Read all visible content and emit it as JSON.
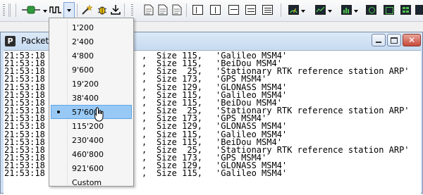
{
  "window": {
    "title": "Packet C"
  },
  "console_lines": [
    {
      "time": "21:53:18",
      "mid": ",",
      "size": "Size 115,",
      "msg": "'Galileo MSM4'"
    },
    {
      "time": "21:53:18",
      "mid": ",",
      "size": "Size 115,",
      "msg": "'BeiDou MSM4'"
    },
    {
      "time": "21:53:18",
      "mid": ",",
      "size": "Size  25,",
      "msg": "'Stationary RTK reference station ARP'"
    },
    {
      "time": "21:53:18",
      "mid": ",",
      "size": "Size 173,",
      "msg": "'GPS MSM4'"
    },
    {
      "time": "21:53:18",
      "mid": ",",
      "size": "Size 129,",
      "msg": "'GLONASS MSM4'"
    },
    {
      "time": "21:53:18",
      "mid": ",",
      "size": "Size 115,",
      "msg": "'Galileo MSM4'"
    },
    {
      "time": "21:53:18",
      "mid": ",",
      "size": "Size 115,",
      "msg": "'BeiDou MSM4'"
    },
    {
      "time": "21:53:18",
      "mid": ",",
      "size": "Size  25,",
      "msg": "'Stationary RTK reference station ARP'"
    },
    {
      "time": "21:53:18",
      "mid": ",",
      "size": "Size 173,",
      "msg": "'GPS MSM4'"
    },
    {
      "time": "21:53:18",
      "mid": ",",
      "size": "Size 129,",
      "msg": "'GLONASS MSM4'"
    },
    {
      "time": "21:53:18",
      "mid": ",",
      "size": "Size 115,",
      "msg": "'Galileo MSM4'"
    },
    {
      "time": "21:53:18",
      "mid": ",",
      "size": "Size 115,",
      "msg": "'BeiDou MSM4'"
    },
    {
      "time": "21:53:18",
      "mid": ",",
      "size": "Size  25,",
      "msg": "'Stationary RTK reference station ARP'"
    },
    {
      "time": "21:53:18",
      "mid": ",",
      "size": "Size 173,",
      "msg": "'GPS MSM4'"
    },
    {
      "time": "21:53:18",
      "mid": ",",
      "size": "Size 129,",
      "msg": "'GLONASS MSM4'"
    },
    {
      "time": "21:53:18",
      "mid": ",",
      "size": "Size 115,",
      "msg": "'Galileo MSM4'"
    }
  ],
  "baud_menu": {
    "items": [
      "1'200",
      "2'400",
      "4'800",
      "9'600",
      "19'200",
      "38'400",
      "57'600",
      "115'200",
      "230'400",
      "460'800",
      "921'600",
      "Custom"
    ],
    "selected": "57'600"
  },
  "toolbar_icons": [
    "connect-icon",
    "serial-signal-icon",
    "magic-wand-icon",
    "bug-icon",
    "download-icon",
    "document-icon",
    "document-icon",
    "document-icon",
    "document-icon",
    "window-layout-icon",
    "window-layout-icon",
    "window-layout-icon",
    "window-layout-icon",
    "window-layout-icon",
    "gauge-icon",
    "chart-icon",
    "bar-chart-icon",
    "camera-icon",
    "settings-window-icon",
    "grid-icon"
  ],
  "colors": {
    "menu_highlight": "#98c9f5",
    "window_frame": "#cfe0f3",
    "close_button": "#c7493a"
  }
}
